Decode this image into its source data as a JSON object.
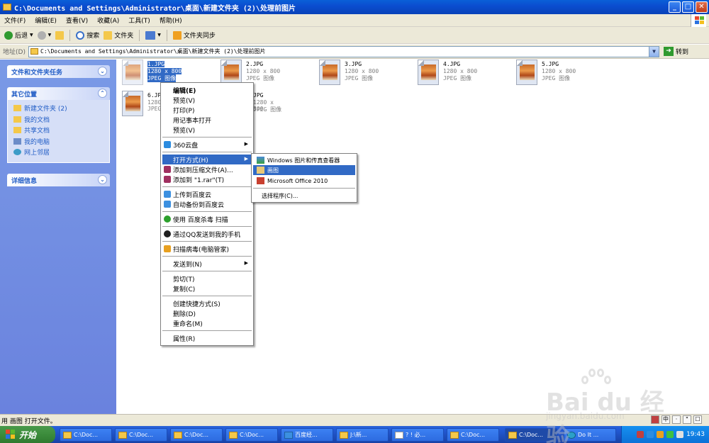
{
  "window": {
    "title": "C:\\Documents and Settings\\Administrator\\桌面\\新建文件夹 (2)\\处理前图片",
    "min": "_",
    "max": "□",
    "close": "✕"
  },
  "menu": [
    "文件(F)",
    "编辑(E)",
    "查看(V)",
    "收藏(A)",
    "工具(T)",
    "帮助(H)"
  ],
  "toolbar": {
    "back": "后退",
    "search": "搜索",
    "folders": "文件夹",
    "sync": "文件夹同步"
  },
  "address": {
    "label": "地址(D)",
    "value": "C:\\Documents and Settings\\Administrator\\桌面\\新建文件夹 (2)\\处理前图片",
    "go": "转到"
  },
  "leftpane": {
    "tasks_title": "文件和文件夹任务",
    "places_title": "其它位置",
    "places": [
      "新建文件夹 (2)",
      "我的文档",
      "共享文档",
      "我的电脑",
      "网上邻居"
    ],
    "details_title": "详细信息"
  },
  "files": [
    {
      "name": "1.JPG",
      "dims": "1280 x 800",
      "type": "JPEG 图像"
    },
    {
      "name": "2.JPG",
      "dims": "1280 x 800",
      "type": "JPEG 图像"
    },
    {
      "name": "3.JPG",
      "dims": "1280 x 800",
      "type": "JPEG 图像"
    },
    {
      "name": "4.JPG",
      "dims": "1280 x 800",
      "type": "JPEG 图像"
    },
    {
      "name": "5.JPG",
      "dims": "1280 x 800",
      "type": "JPEG 图像"
    },
    {
      "name": "6.JPG",
      "dims": "1280",
      "type": "JPEG"
    },
    {
      "name": "JPG",
      "dims": "1280 x 800",
      "type": "JPEG 图像"
    }
  ],
  "context_menu": {
    "edit": "编辑(E)",
    "preview": "预览(V)",
    "print": "打印(P)",
    "notepad": "用记事本打开",
    "preview2": "预览(V)",
    "cloud360": "360云盘",
    "openwith": "打开方式(H)",
    "addzip": "添加到压缩文件(A)...",
    "addrar": "添加到 \"1.rar\"(T)",
    "upload_baidu": "上传到百度云",
    "backup_baidu": "自动备份到百度云",
    "scan_baidu": "使用 百度杀毒 扫描",
    "qq_phone": "通过QQ发送到我的手机",
    "scan_pc": "扫描病毒(电脑管家)",
    "sendto": "发送到(N)",
    "cut": "剪切(T)",
    "copy": "复制(C)",
    "shortcut": "创建快捷方式(S)",
    "delete": "删除(D)",
    "rename": "重命名(M)",
    "props": "属性(R)"
  },
  "submenu": {
    "viewer": "Windows 图片和传真查看器",
    "paint": "画图",
    "office": "Microsoft Office 2010",
    "choose": "选择程序(C)..."
  },
  "status": "用 画图 打开文件。",
  "ime": [
    "中",
    "·",
    "\"",
    "☐"
  ],
  "taskbar": {
    "start": "开始",
    "buttons": [
      "C:\\Doc...",
      "C:\\Doc...",
      "C:\\Doc...",
      "C:\\Doc...",
      "百度经...",
      "J:\\新...",
      "? ! 必...",
      "C:\\Doc...",
      "C:\\Doc...",
      "Do It ..."
    ],
    "clock": "19:43"
  },
  "watermark": {
    "brand": "Bai du 经验",
    "url": "jingyan.baidu.com"
  },
  "colors": {
    "title_blue": "#0b4ed0",
    "selection": "#316ac5",
    "taskpane": "#6a82de",
    "start_green": "#3c8c3c"
  }
}
